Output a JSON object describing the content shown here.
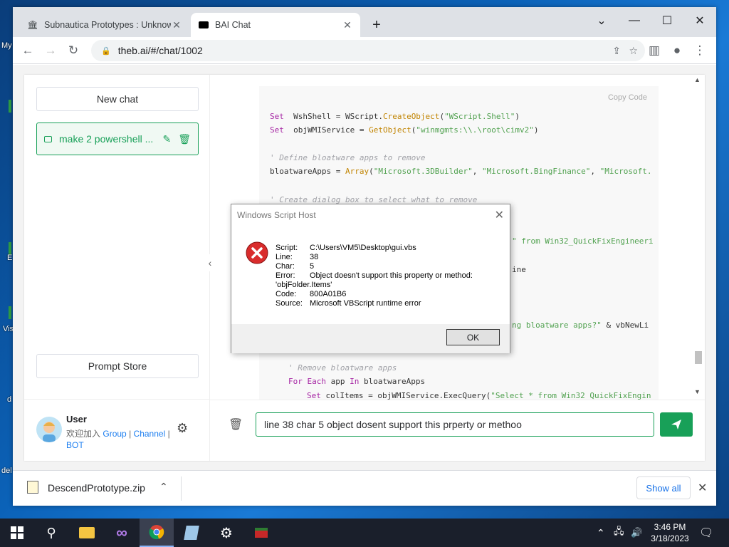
{
  "desktop": {
    "labels": [
      "My",
      "E",
      "Vis",
      "d",
      "del"
    ]
  },
  "browser": {
    "tabs": [
      {
        "title": "Subnautica Prototypes : Unknown",
        "active": false
      },
      {
        "title": "BAI Chat",
        "active": true
      }
    ],
    "url": "theb.ai/#/chat/1002"
  },
  "sidebar": {
    "new_chat": "New chat",
    "chat_item": "make 2 powershell ...",
    "prompt_store": "Prompt Store",
    "user": {
      "name": "User",
      "welcome": "欢迎加入",
      "group": "Group",
      "sep1": "|",
      "channel": "Channel",
      "sep2": "|",
      "bot": "BOT"
    }
  },
  "code": {
    "copy_label": "Copy Code",
    "lines": [
      {
        "parts": [
          [
            "kw",
            "Set"
          ],
          [
            "",
            "  WshShell = WScript."
          ],
          [
            "fn",
            "CreateObject"
          ],
          [
            "",
            "("
          ],
          [
            "str",
            "\"WScript.Shell\""
          ],
          [
            "",
            ")"
          ]
        ]
      },
      {
        "parts": [
          [
            "kw",
            "Set"
          ],
          [
            "",
            "  objWMIService = "
          ],
          [
            "fn",
            "GetObject"
          ],
          [
            "",
            "("
          ],
          [
            "str",
            "\"winmgmts:\\\\.\\root\\cimv2\""
          ],
          [
            "",
            ")"
          ]
        ]
      },
      {
        "parts": [
          [
            "cm",
            "' Define bloatware apps to remove"
          ]
        ]
      },
      {
        "parts": [
          [
            "",
            "bloatwareApps = "
          ],
          [
            "fn",
            "Array"
          ],
          [
            "",
            "("
          ],
          [
            "str",
            "\"Microsoft.3DBuilder\""
          ],
          [
            "",
            ", "
          ],
          [
            "str",
            "\"Microsoft.BingFinance\""
          ],
          [
            "",
            ", "
          ],
          [
            "str",
            "\"Microsoft."
          ]
        ]
      },
      {
        "parts": [
          [
            "cm",
            "' Create dialog box to select what to remove"
          ]
        ]
      },
      {
        "parts": [
          [
            "str",
            "\" from Win32_QuickFixEngineeri"
          ]
        ]
      },
      {
        "parts": [
          [
            "",
            "ine"
          ]
        ]
      },
      {
        "parts": [
          [
            "str",
            "ng bloatware apps?\""
          ],
          [
            "",
            " & vbNewLi"
          ]
        ]
      },
      {
        "parts": [
          [
            "cm",
            "' Remove bloatware apps"
          ]
        ]
      },
      {
        "parts": [
          [
            "kw",
            "For Each"
          ],
          [
            "",
            " app "
          ],
          [
            "kw",
            "In"
          ],
          [
            "",
            " bloatwareApps"
          ]
        ]
      },
      {
        "parts": [
          [
            "kw",
            "Set"
          ],
          [
            "",
            " colItems = objWMIService.ExecQuery("
          ],
          [
            "str",
            "\"Select * from Win32_QuickFixEngin"
          ]
        ]
      }
    ]
  },
  "input": {
    "value": "line 38 char 5 object dosent support this prperty or methoo"
  },
  "dialog": {
    "title": "Windows Script Host",
    "rows": [
      {
        "label": "Script:",
        "value": "C:\\Users\\VM5\\Desktop\\gui.vbs"
      },
      {
        "label": "Line:",
        "value": "38"
      },
      {
        "label": "Char:",
        "value": "5"
      },
      {
        "label": "Error:",
        "value": "Object doesn't support this property or method:"
      },
      {
        "label": "",
        "value": "'objFolder.Items'"
      },
      {
        "label": "Code:",
        "value": "800A01B6"
      },
      {
        "label": "Source:",
        "value": "Microsoft VBScript runtime error"
      }
    ],
    "ok": "OK"
  },
  "downloads": {
    "file": "DescendPrototype.zip",
    "show_all": "Show all"
  },
  "taskbar": {
    "time": "3:46 PM",
    "date": "3/18/2023"
  }
}
